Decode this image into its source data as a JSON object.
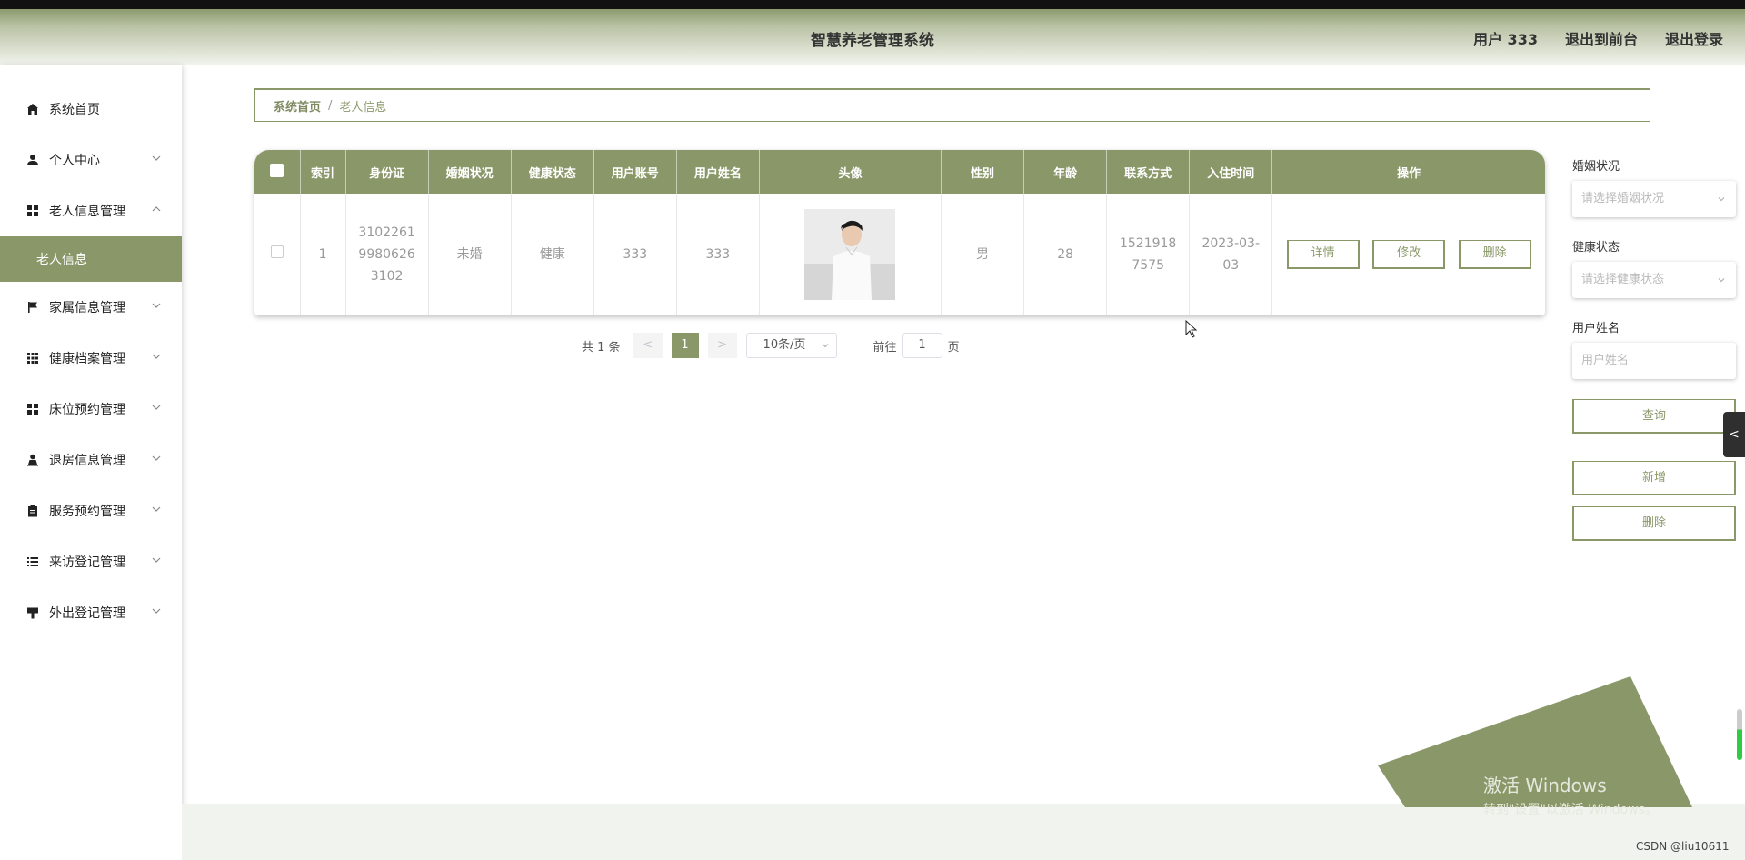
{
  "header": {
    "title": "智慧养老管理系统",
    "user": "用户 333",
    "front": "退出到前台",
    "logout": "退出登录"
  },
  "sidebar": {
    "items": [
      {
        "label": "系统首页",
        "icon": "home-icon"
      },
      {
        "label": "个人中心",
        "icon": "user-icon"
      },
      {
        "label": "老人信息管理",
        "icon": "grid-icon"
      },
      {
        "label": "家属信息管理",
        "icon": "flag-icon"
      },
      {
        "label": "健康档案管理",
        "icon": "grid9-icon"
      },
      {
        "label": "床位预约管理",
        "icon": "grid-icon"
      },
      {
        "label": "退房信息管理",
        "icon": "person-icon"
      },
      {
        "label": "服务预约管理",
        "icon": "clipboard-icon"
      },
      {
        "label": "来访登记管理",
        "icon": "list-icon"
      },
      {
        "label": "外出登记管理",
        "icon": "sign-icon"
      }
    ],
    "subitem": "老人信息"
  },
  "breadcrumb": {
    "home": "系统首页",
    "sep": "/",
    "current": "老人信息"
  },
  "table": {
    "columns": [
      "索引",
      "身份证",
      "婚姻状况",
      "健康状态",
      "用户账号",
      "用户姓名",
      "头像",
      "性别",
      "年龄",
      "联系方式",
      "入住时间",
      "操作"
    ],
    "rows": [
      {
        "index": "1",
        "id": "310226199806263102",
        "marital": "未婚",
        "health": "健康",
        "account": "333",
        "name": "333",
        "gender": "男",
        "age": "28",
        "phone": "15219187575",
        "checkin": "2023-03-03"
      }
    ],
    "actions": {
      "detail": "详情",
      "edit": "修改",
      "delete": "删除"
    }
  },
  "pager": {
    "total": "共 1 条",
    "prev": "<",
    "page": "1",
    "next": ">",
    "size": "10条/页",
    "goto_pre": "前往",
    "goto_val": "1",
    "goto_post": "页"
  },
  "filters": {
    "marital_label": "婚姻状况",
    "marital_ph": "请选择婚姻状况",
    "health_label": "健康状态",
    "health_ph": "请选择健康状态",
    "name_label": "用户姓名",
    "name_ph": "用户姓名",
    "search": "查询",
    "add": "新增",
    "delete": "删除"
  },
  "misc": {
    "watermark": "激活 Windows",
    "watermark_sub": "转到\"设置\"以激活 Windows。",
    "credit": "CSDN @liu10611",
    "side_tab": "<"
  },
  "colors": {
    "accent": "#8a9869"
  }
}
